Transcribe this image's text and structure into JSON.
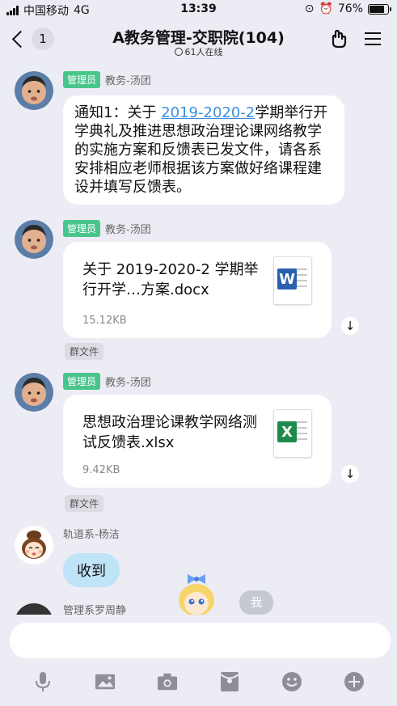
{
  "status": {
    "carrier": "中国移动",
    "network": "4G",
    "time": "13:39",
    "battery": "76%"
  },
  "nav": {
    "back_count": "1",
    "title": "A教务管理-交职院(104)",
    "online": "61人在线"
  },
  "messages": [
    {
      "role": "管理员",
      "sender": "教务-汤团",
      "text_prefix": "通知1：关于 ",
      "link": "2019-2020-2",
      "text_suffix": "学期举行开学典礼及推进思想政治理论课网络教学的实施方案和反馈表已发文件，请各系安排相应老师根据该方案做好络课程建设并填写反馈表。"
    },
    {
      "role": "管理员",
      "sender": "教务-汤团",
      "file_name": "关于 2019-2020-2 学期举行开学…方案.docx",
      "file_size": "15.12KB",
      "file_type": "W",
      "tag": "群文件"
    },
    {
      "role": "管理员",
      "sender": "教务-汤团",
      "file_name": "思想政治理论课教学网络测试反馈表.xlsx",
      "file_size": "9.42KB",
      "file_type": "X",
      "tag": "群文件"
    },
    {
      "sender": "轨道系-杨洁",
      "text": "收到"
    },
    {
      "sender": "管理系罗周静"
    }
  ],
  "my_message": "我",
  "input": {
    "placeholder": ""
  },
  "toolbar": [
    "microphone-icon",
    "image-icon",
    "camera-icon",
    "red-packet-icon",
    "emoji-icon",
    "plus-icon"
  ],
  "colors": {
    "accent": "#3a8ddf",
    "badge": "#49c58c",
    "word": "#2b5faf",
    "excel": "#1f8a4c",
    "cloud": "#bfe3f7"
  }
}
